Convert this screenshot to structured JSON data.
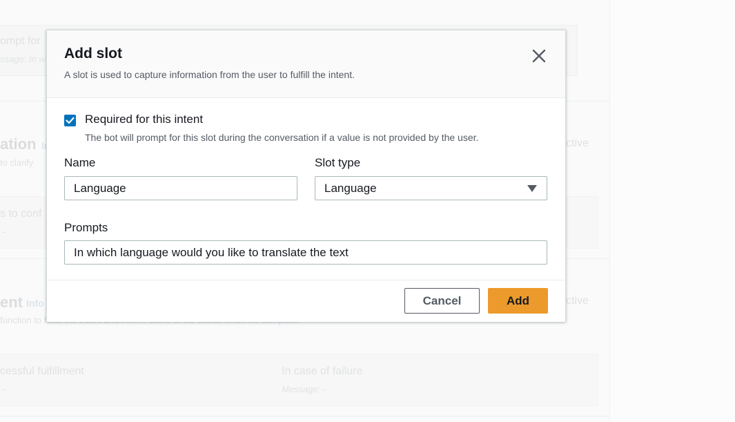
{
  "background": {
    "prompt_fragment": "ompt for",
    "message_fragment": "ssage: In w",
    "section1_heading": "ation",
    "section1_info": "In",
    "section1_desc": "to clarify",
    "section1_active": "ctive",
    "section1_sub": "s to conf",
    "section1_sub_value": "-",
    "section2_heading": "ent",
    "section2_info": "Info",
    "section2_desc": "function to fulfill the intent and inform users of the status when it's complete.",
    "section2_active": "ctive",
    "success_label": "cessful fulfillment",
    "success_value": "-",
    "failure_label": "In case of failure",
    "failure_value": "Message: -"
  },
  "modal": {
    "title": "Add slot",
    "description": "A slot is used to capture information from the user to fulfill the intent.",
    "close_icon": "close-icon"
  },
  "required": {
    "checked": true,
    "label": "Required for this intent",
    "description": "The bot will prompt for this slot during the conversation if a value is not provided by the user."
  },
  "name": {
    "label": "Name",
    "value": "Language"
  },
  "slot_type": {
    "label": "Slot type",
    "value": "Language",
    "icon": "caret-down-icon"
  },
  "prompts": {
    "label": "Prompts",
    "value": "In which language would you like to translate the text"
  },
  "footer": {
    "cancel_label": "Cancel",
    "add_label": "Add"
  },
  "colors": {
    "primary_button": "#ec9a2b",
    "checkbox": "#0073bb",
    "text": "#16191f",
    "muted_text": "#545b64"
  }
}
